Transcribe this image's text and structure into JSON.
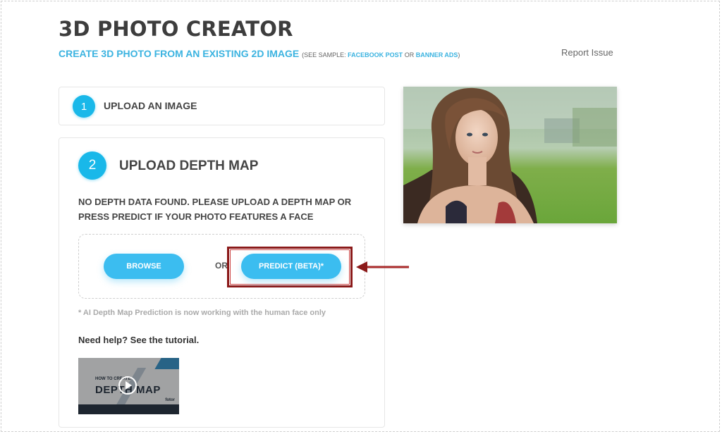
{
  "header": {
    "title": "3D PHOTO CREATOR",
    "subtitle": "CREATE 3D PHOTO FROM AN EXISTING 2D IMAGE",
    "sample_prefix": "(SEE SAMPLE:",
    "sample_link1": "FACEBOOK POST",
    "sample_or": "OR",
    "sample_link2": "BANNER ADS",
    "sample_suffix": ")",
    "report_issue": "Report Issue"
  },
  "step1": {
    "number": "1",
    "label": "UPLOAD AN IMAGE"
  },
  "step2": {
    "number": "2",
    "label": "UPLOAD DEPTH MAP",
    "instruction": "NO DEPTH DATA FOUND. PLEASE UPLOAD A DEPTH MAP OR PRESS PREDICT IF YOUR PHOTO FEATURES A FACE",
    "browse_label": "BROWSE",
    "or_label": "OR",
    "predict_label": "PREDICT (BETA)*",
    "note": "* AI Depth Map Prediction is now working with the human face only",
    "help_text": "Need help? See the tutorial.",
    "video": {
      "small_text": "HOW TO CREATE",
      "big_text": "DEPTH MAP",
      "logo_text": "fotor"
    }
  },
  "colors": {
    "accent": "#19b8e9",
    "button": "#3bbdf0",
    "highlight_border": "#8b1a1a"
  },
  "icons": {
    "play": "play-icon",
    "arrow": "arrow-left-icon"
  }
}
